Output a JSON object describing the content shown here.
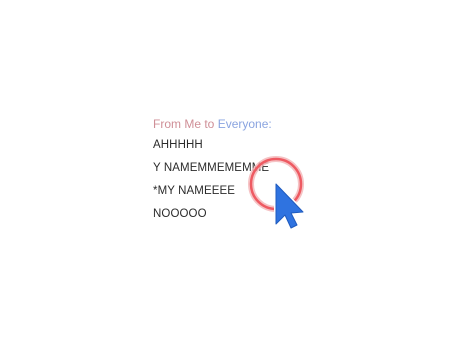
{
  "chat": {
    "header": {
      "from": "From Me",
      "to": "to",
      "recipient": "Everyone:"
    },
    "messages": [
      {
        "text": "AHHHHH"
      },
      {
        "text": "Y NAMEMMEMEMME"
      },
      {
        "text": "*MY NAMEEEE"
      },
      {
        "text": "NOOOOO"
      }
    ]
  },
  "cursor": {
    "icon": "pointer-arrow-icon",
    "highlight_icon": "click-ring-icon",
    "arrow_color": "#2f73e0",
    "ring_color": "#ee5a62"
  }
}
